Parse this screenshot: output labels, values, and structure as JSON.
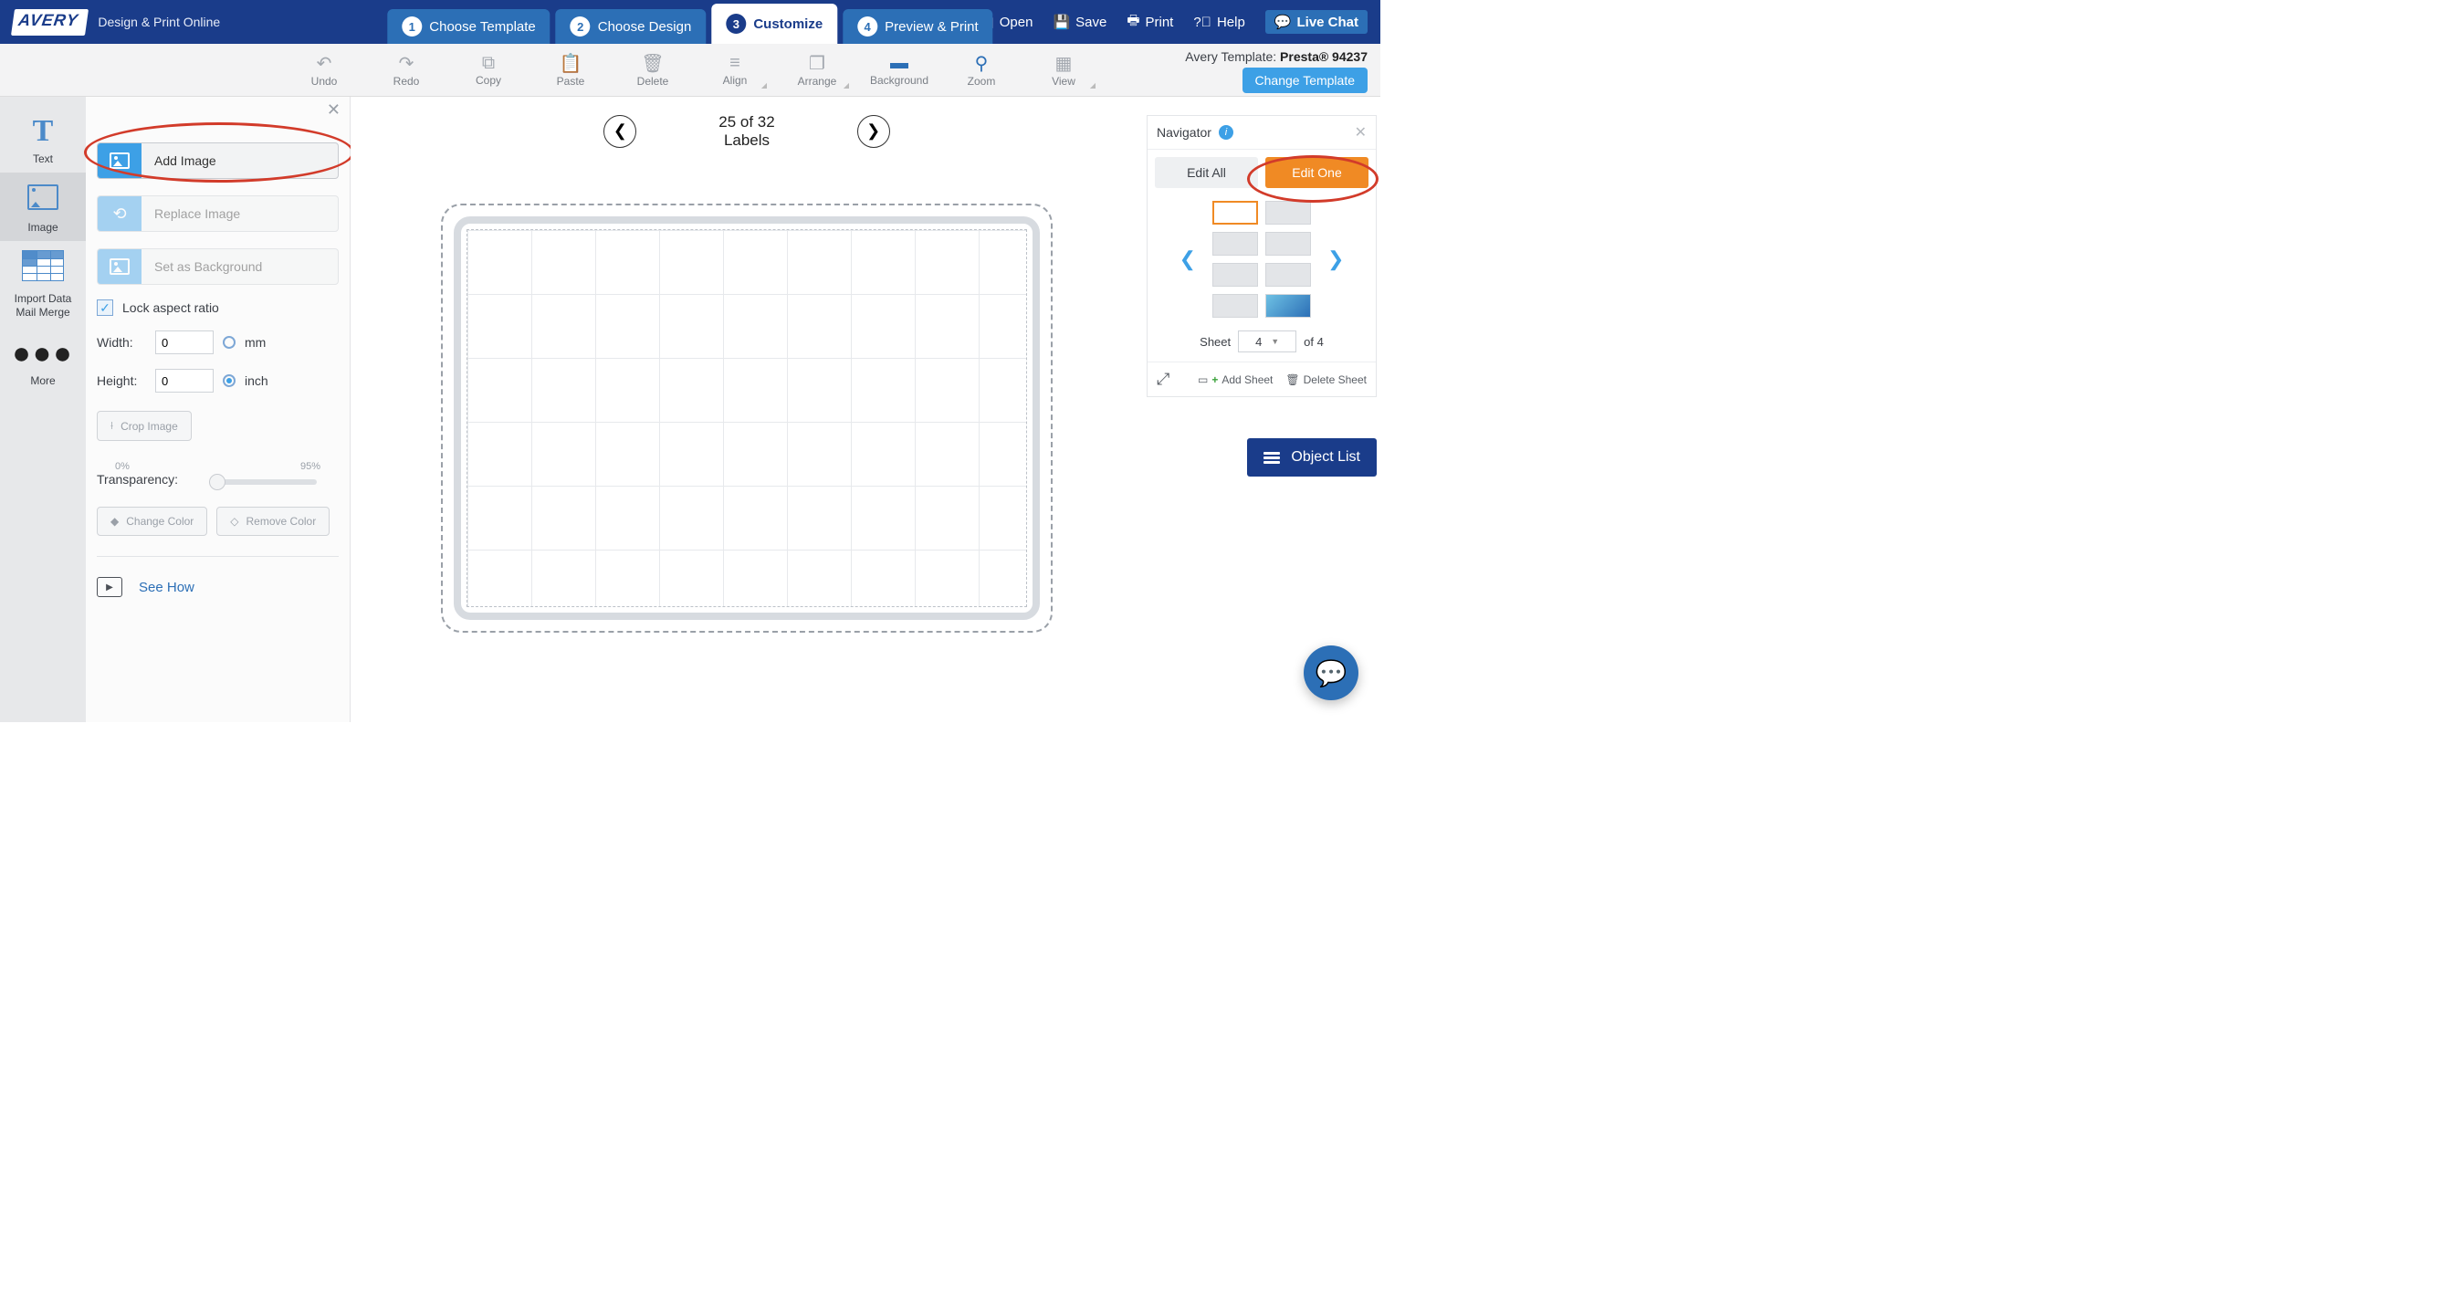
{
  "header": {
    "logo_text": "AVERY",
    "subtitle": "Design & Print Online",
    "steps": [
      {
        "num": "1",
        "label": "Choose Template"
      },
      {
        "num": "2",
        "label": "Choose Design"
      },
      {
        "num": "3",
        "label": "Customize"
      },
      {
        "num": "4",
        "label": "Preview & Print"
      }
    ],
    "open": "Open",
    "save": "Save",
    "print": "Print",
    "help": "Help",
    "live_chat": "Live Chat"
  },
  "toolbar": {
    "undo": "Undo",
    "redo": "Redo",
    "copy": "Copy",
    "paste": "Paste",
    "delete": "Delete",
    "align": "Align",
    "arrange": "Arrange",
    "background": "Background",
    "zoom": "Zoom",
    "view": "View",
    "template_prefix": "Avery Template: ",
    "template_name": "Presta® 94237",
    "change_template": "Change Template"
  },
  "rail": {
    "text": "Text",
    "image": "Image",
    "import_data": "Import Data",
    "mail_merge": "Mail Merge",
    "more": "More"
  },
  "panel": {
    "add_image": "Add Image",
    "replace_image": "Replace Image",
    "set_background": "Set as Background",
    "lock_aspect": "Lock aspect ratio",
    "width": "Width:",
    "height": "Height:",
    "width_val": "0",
    "height_val": "0",
    "unit_mm": "mm",
    "unit_inch": "inch",
    "crop": "Crop Image",
    "transparency": "Transparency:",
    "transp_min": "0%",
    "transp_max": "95%",
    "change_color": "Change Color",
    "remove_color": "Remove Color",
    "see_how": "See How"
  },
  "canvas": {
    "counter_top": "25 of 32",
    "counter_bottom": "Labels"
  },
  "navigator": {
    "title": "Navigator",
    "edit_all": "Edit All",
    "edit_one": "Edit One",
    "sheet_label": "Sheet",
    "sheet_value": "4",
    "sheet_total": "of 4",
    "add_sheet": "Add Sheet",
    "delete_sheet": "Delete Sheet"
  },
  "object_list": "Object List"
}
